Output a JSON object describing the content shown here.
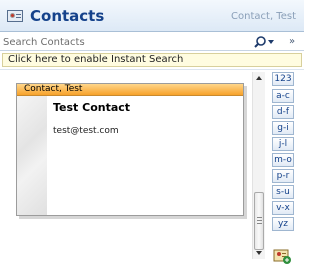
{
  "header": {
    "title": "Contacts",
    "current_contact": "Contact, Test"
  },
  "search": {
    "placeholder": "Search Contacts"
  },
  "instant_search": {
    "label": "Click here to enable Instant Search"
  },
  "card": {
    "file_as": "Contact, Test",
    "full_name": "Test Contact",
    "email": "test@test.com"
  },
  "index": {
    "buttons": [
      "123",
      "a-c",
      "d-f",
      "g-i",
      "j-l",
      "m-o",
      "p-r",
      "s-u",
      "v-x",
      "yz"
    ]
  },
  "icons": {
    "header": "contacts-card-icon",
    "search": "magnifier-icon",
    "new_contact": "new-contact-icon"
  },
  "colors": {
    "title": "#15428b",
    "card_header": "#f7a22b",
    "instant_bar": "#fffce0"
  }
}
